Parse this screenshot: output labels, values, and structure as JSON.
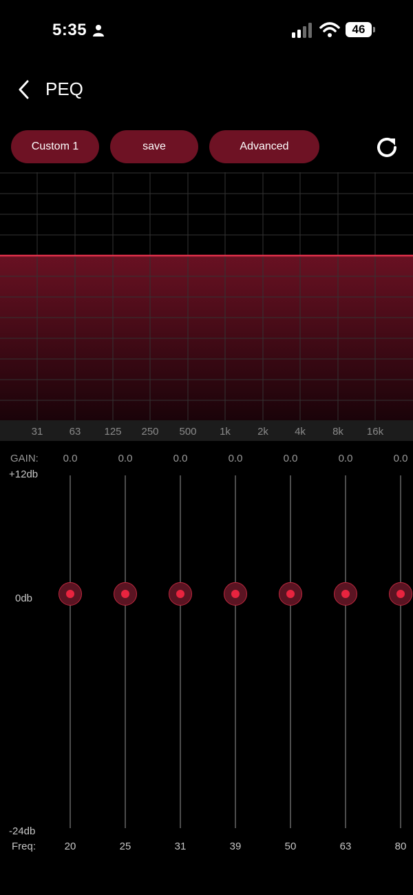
{
  "status_bar": {
    "time": "5:35",
    "battery": "46"
  },
  "header": {
    "title": "PEQ"
  },
  "toolbar": {
    "preset_label": "Custom 1",
    "save_label": "save",
    "advanced_label": "Advanced"
  },
  "graph": {
    "freq_ticks": [
      "31",
      "63",
      "125",
      "250",
      "500",
      "1k",
      "2k",
      "4k",
      "8k",
      "16k"
    ],
    "colors": {
      "fill": "#6e1224",
      "curve": "#e0304a",
      "grid": "#333333"
    }
  },
  "gain_panel": {
    "gain_label": "GAIN:",
    "max_label": "+12db",
    "zero_label": "0db",
    "min_label": "-24db",
    "freq_label": "Freq:",
    "bands": [
      {
        "gain": "0.0",
        "freq": "20"
      },
      {
        "gain": "0.0",
        "freq": "25"
      },
      {
        "gain": "0.0",
        "freq": "31"
      },
      {
        "gain": "0.0",
        "freq": "39"
      },
      {
        "gain": "0.0",
        "freq": "50"
      },
      {
        "gain": "0.0",
        "freq": "63"
      },
      {
        "gain": "0.0",
        "freq": "80"
      }
    ]
  }
}
